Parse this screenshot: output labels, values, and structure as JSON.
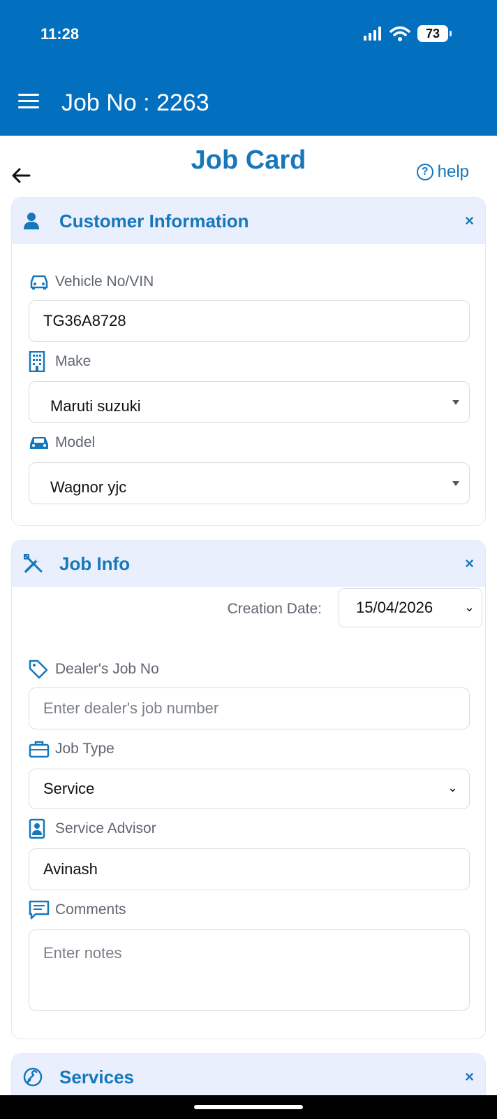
{
  "status": {
    "time": "11:28",
    "battery": "73"
  },
  "header": {
    "title": "Job No : 2263"
  },
  "page": {
    "title": "Job Card",
    "help_label": "help"
  },
  "customer_info": {
    "title": "Customer Information",
    "close": "×",
    "vehicle": {
      "label": "Vehicle No/VIN",
      "value": "TG36A8728"
    },
    "make": {
      "label": "Make",
      "value": "Maruti suzuki"
    },
    "model": {
      "label": "Model",
      "value": "Wagnor yjc"
    }
  },
  "job_info": {
    "title": "Job Info",
    "close": "×",
    "creation_date": {
      "label": "Creation Date:",
      "value": "15/04/2026"
    },
    "dealer_job": {
      "label": "Dealer's Job No",
      "placeholder": "Enter dealer's job number"
    },
    "job_type": {
      "label": "Job Type",
      "value": "Service"
    },
    "service_advisor": {
      "label": "Service Advisor",
      "value": "Avinash"
    },
    "comments": {
      "label": "Comments",
      "placeholder": "Enter notes"
    }
  },
  "services": {
    "title": "Services",
    "close": "×"
  },
  "colors": {
    "primary": "#0370bf",
    "accent": "#1677bb",
    "header_bg": "#e9effd"
  },
  "icons": {
    "menu": "hamburger-icon",
    "back": "back-arrow-icon",
    "help": "question-circle-icon",
    "customer": "person-icon",
    "vehicle": "car-icon",
    "make": "building-icon",
    "model": "car-icon",
    "job": "tools-icon",
    "tag": "tag-icon",
    "briefcase": "briefcase-icon",
    "advisor": "badge-icon",
    "comments": "chat-icon",
    "services": "service-icon"
  }
}
